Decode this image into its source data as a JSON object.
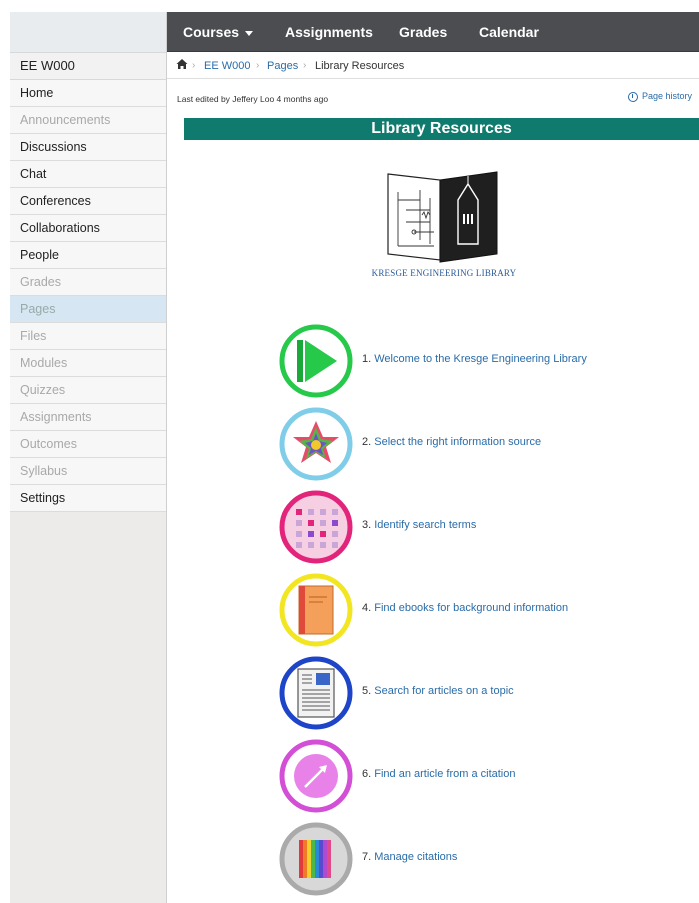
{
  "topnav": {
    "courses": "Courses",
    "assignments": "Assignments",
    "grades": "Grades",
    "calendar": "Calendar"
  },
  "sidebar": {
    "course_code": "EE W000",
    "items": [
      {
        "label": "Home",
        "state": "enabled"
      },
      {
        "label": "Announcements",
        "state": "disabled"
      },
      {
        "label": "Discussions",
        "state": "enabled"
      },
      {
        "label": "Chat",
        "state": "enabled"
      },
      {
        "label": "Conferences",
        "state": "enabled"
      },
      {
        "label": "Collaborations",
        "state": "enabled"
      },
      {
        "label": "People",
        "state": "enabled"
      },
      {
        "label": "Grades",
        "state": "disabled"
      },
      {
        "label": "Pages",
        "state": "active"
      },
      {
        "label": "Files",
        "state": "disabled"
      },
      {
        "label": "Modules",
        "state": "disabled"
      },
      {
        "label": "Quizzes",
        "state": "disabled"
      },
      {
        "label": "Assignments",
        "state": "disabled"
      },
      {
        "label": "Outcomes",
        "state": "disabled"
      },
      {
        "label": "Syllabus",
        "state": "disabled"
      },
      {
        "label": "Settings",
        "state": "enabled"
      }
    ]
  },
  "breadcrumb": {
    "course": "EE W000",
    "pages": "Pages",
    "current": "Library Resources"
  },
  "page": {
    "edited": "Last edited by Jeffery Loo 4 months ago",
    "history": "Page history",
    "banner": "Library Resources",
    "logo_caption": "KRESGE ENGINEERING LIBRARY"
  },
  "modules": [
    {
      "num": "1.",
      "title": "Welcome to the Kresge Engineering Library",
      "ring": "#27c94a",
      "icon": "play-icon"
    },
    {
      "num": "2.",
      "title": "Select the right information source",
      "ring": "#7fcde8",
      "icon": "star-icon"
    },
    {
      "num": "3.",
      "title": "Identify search terms",
      "ring": "#e2257a",
      "icon": "grid-icon"
    },
    {
      "num": "4.",
      "title": "Find ebooks for background information",
      "ring": "#f2e622",
      "icon": "book-icon"
    },
    {
      "num": "5.",
      "title": "Search for articles on a topic",
      "ring": "#1e45c8",
      "icon": "article-icon"
    },
    {
      "num": "6.",
      "title": "Find an article from a citation",
      "ring": "#d24fd6",
      "icon": "arrow-icon"
    },
    {
      "num": "7.",
      "title": "Manage citations",
      "ring": "#aaaaaa",
      "icon": "citations-icon"
    }
  ]
}
